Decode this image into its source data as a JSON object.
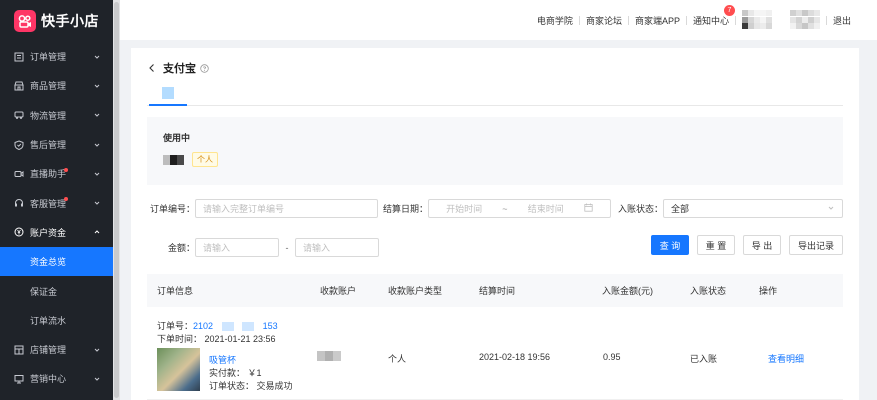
{
  "brand": {
    "name": "快手小店",
    "color": "#fe3666"
  },
  "sidebar": {
    "items": [
      {
        "label": "订单管理",
        "icon": "order-icon",
        "dot": false
      },
      {
        "label": "商品管理",
        "icon": "goods-icon",
        "dot": false
      },
      {
        "label": "物流管理",
        "icon": "truck-icon",
        "dot": false
      },
      {
        "label": "售后管理",
        "icon": "shield-icon",
        "dot": false
      },
      {
        "label": "直播助手",
        "icon": "live-icon",
        "dot": true
      },
      {
        "label": "客服管理",
        "icon": "headset-icon",
        "dot": true
      },
      {
        "label": "账户资金",
        "icon": "yen-icon",
        "dot": false,
        "open": true
      }
    ],
    "subitems": [
      {
        "label": "资金总览",
        "active": true
      },
      {
        "label": "保证金",
        "active": false
      },
      {
        "label": "订单流水",
        "active": false
      }
    ],
    "items_after": [
      {
        "label": "店铺管理",
        "icon": "store-icon"
      },
      {
        "label": "营销中心",
        "icon": "monitor-icon"
      }
    ]
  },
  "topbar": {
    "links": [
      "电商学院",
      "商家论坛",
      "商家端APP",
      "通知中心"
    ],
    "notification_count": "7",
    "logout": "退出"
  },
  "page": {
    "title": "支付宝",
    "account_status": "使用中",
    "account_type_tag": "个人"
  },
  "filters": {
    "order_no_label": "订单编号：",
    "order_no_placeholder": "请输入完整订单编号",
    "settle_date_label": "结算日期：",
    "start_placeholder": "开始时间",
    "range_sep": "~",
    "end_placeholder": "结束时间",
    "status_label": "入账状态：",
    "status_value": "全部",
    "amount_label": "金额：",
    "amount_min_placeholder": "请输入",
    "amount_sep": "-",
    "amount_max_placeholder": "请输入",
    "query_btn": "查 询",
    "reset_btn": "重 置",
    "export_btn": "导 出",
    "export_record_btn": "导出记录"
  },
  "table": {
    "headers": [
      "订单信息",
      "收款账户",
      "收款账户类型",
      "结算时间",
      "入账金额(元)",
      "入账状态",
      "操作"
    ],
    "rows": [
      {
        "order_label": "订单号：",
        "order_no_prefix": "2102",
        "order_no_suffix": "153",
        "order_time": "下单时间： 2021-01-21 23:56",
        "product_name": "吸管杯",
        "paid": "实付款： ￥1",
        "order_status": "订单状态： 交易成功",
        "account_type": "个人",
        "settle_time": "2021-02-18 19:56",
        "amount": "0.95",
        "status": "已入账",
        "action": "查看明细"
      }
    ]
  },
  "colors": {
    "primary": "#1677ff",
    "sidebar_bg": "#1f2329",
    "badge": "#ff4d4f"
  }
}
